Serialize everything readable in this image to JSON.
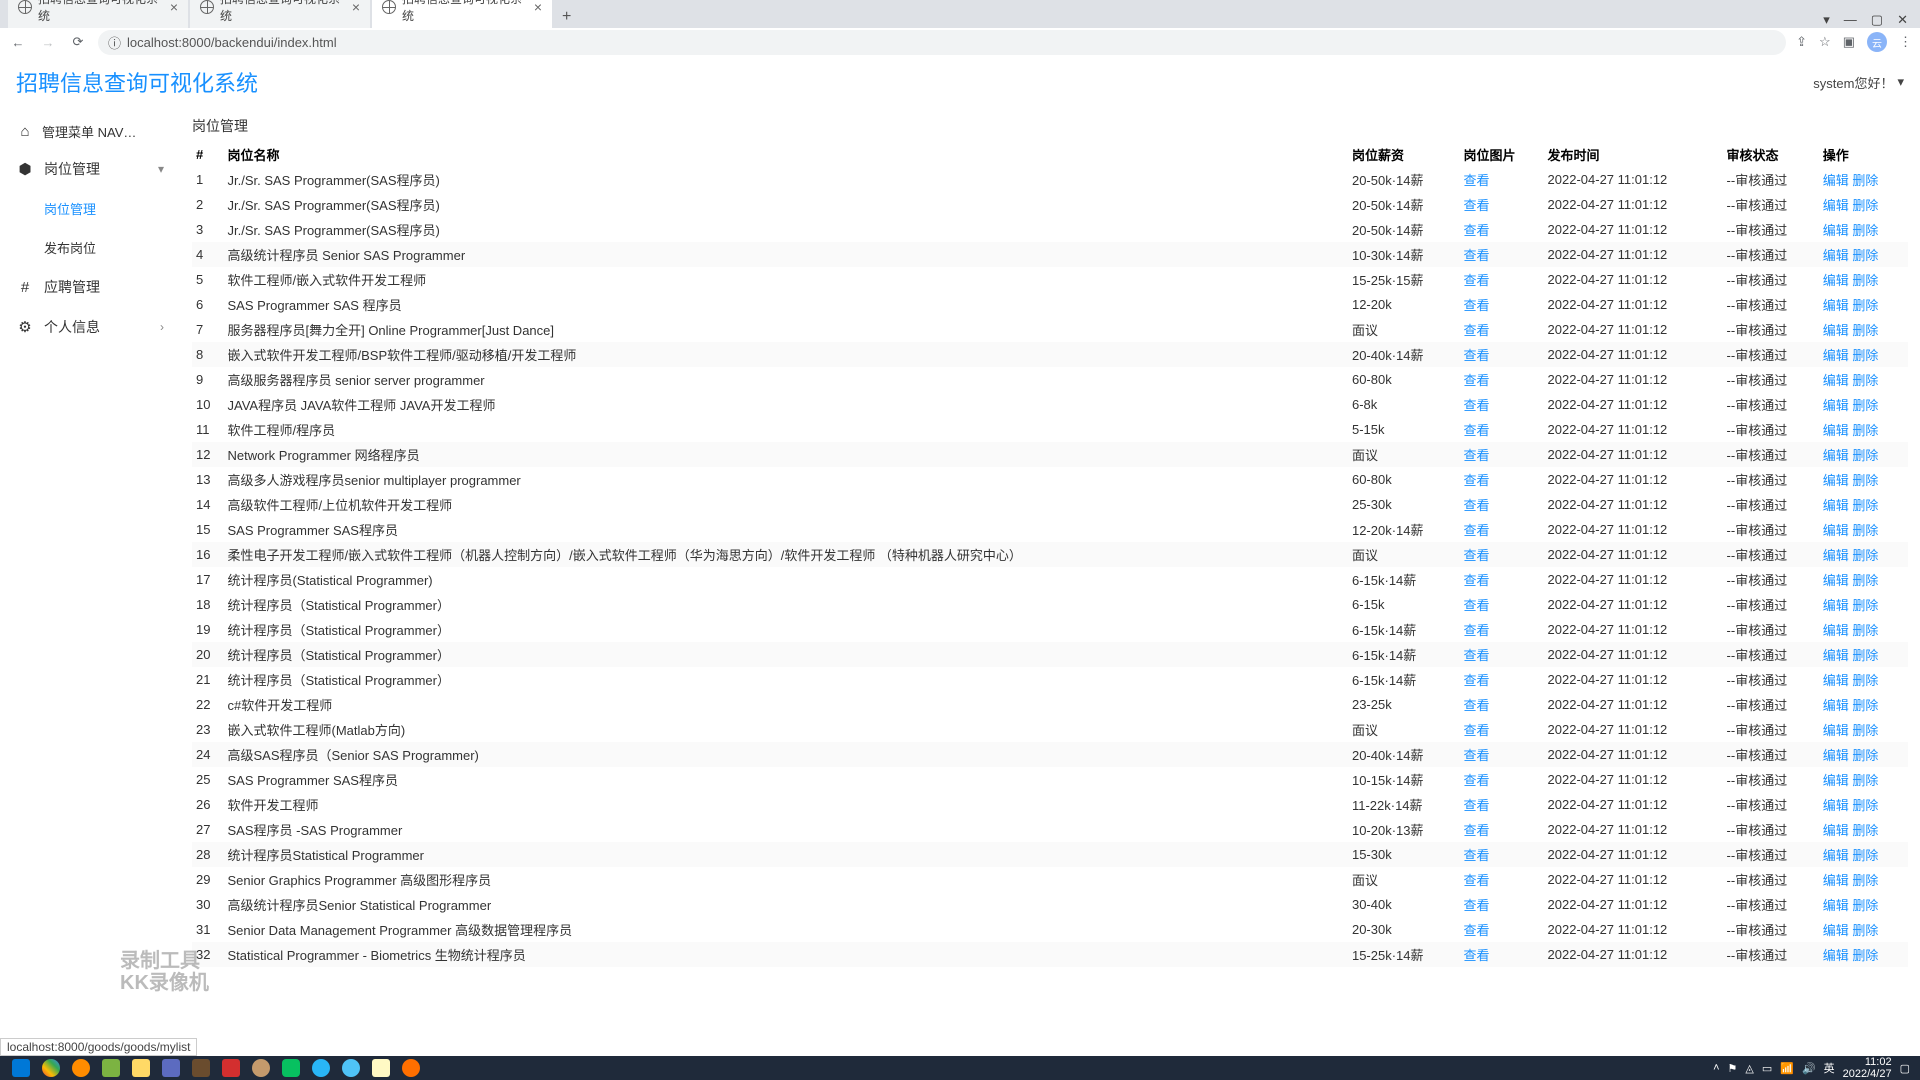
{
  "browser": {
    "tabs": [
      {
        "title": "招聘信息查询可视化系统",
        "active": false
      },
      {
        "title": "招聘信息查询可视化系统",
        "active": false
      },
      {
        "title": "招聘信息查询可视化系统",
        "active": true
      }
    ],
    "url": "localhost:8000/backendui/index.html",
    "status_url": "localhost:8000/goods/goods/mylist"
  },
  "header": {
    "app_title": "招聘信息查询可视化系统",
    "greet": "system您好！"
  },
  "sidebar": {
    "nav_head": "管理菜单 NAV…",
    "items": [
      {
        "label": "岗位管理",
        "icon": "box",
        "expandable": true,
        "state": "open"
      },
      {
        "label": "岗位管理",
        "sub": true,
        "active": true
      },
      {
        "label": "发布岗位",
        "sub": true
      },
      {
        "label": "应聘管理",
        "icon": "hash"
      },
      {
        "label": "个人信息",
        "icon": "gear",
        "expandable": true,
        "state": "closed"
      }
    ]
  },
  "main": {
    "page_title": "岗位管理",
    "columns": {
      "idx": "#",
      "name": "岗位名称",
      "salary": "岗位薪资",
      "img": "岗位图片",
      "time": "发布时间",
      "status": "审核状态",
      "ops": "操作"
    },
    "actions": {
      "view": "查看",
      "edit": "编辑",
      "del": "删除"
    },
    "rows": [
      {
        "i": 1,
        "name": "Jr./Sr. SAS Programmer(SAS程序员)",
        "salary": "20-50k·14薪",
        "img": "查看",
        "time": "2022-04-27 11:01:12",
        "status": "--审核通过"
      },
      {
        "i": 2,
        "name": "Jr./Sr. SAS Programmer(SAS程序员)",
        "salary": "20-50k·14薪",
        "img": "查看",
        "time": "2022-04-27 11:01:12",
        "status": "--审核通过"
      },
      {
        "i": 3,
        "name": "Jr./Sr. SAS Programmer(SAS程序员)",
        "salary": "20-50k·14薪",
        "img": "查看",
        "time": "2022-04-27 11:01:12",
        "status": "--审核通过"
      },
      {
        "i": 4,
        "name": "高级统计程序员 Senior SAS Programmer",
        "salary": "10-30k·14薪",
        "img": "查看",
        "time": "2022-04-27 11:01:12",
        "status": "--审核通过"
      },
      {
        "i": 5,
        "name": "软件工程师/嵌入式软件开发工程师",
        "salary": "15-25k·15薪",
        "img": "查看",
        "time": "2022-04-27 11:01:12",
        "status": "--审核通过"
      },
      {
        "i": 6,
        "name": "SAS Programmer SAS 程序员",
        "salary": "12-20k",
        "img": "查看",
        "time": "2022-04-27 11:01:12",
        "status": "--审核通过"
      },
      {
        "i": 7,
        "name": "服务器程序员[舞力全开] Online Programmer[Just Dance]",
        "salary": "面议",
        "img": "查看",
        "time": "2022-04-27 11:01:12",
        "status": "--审核通过"
      },
      {
        "i": 8,
        "name": "嵌入式软件开发工程师/BSP软件工程师/驱动移植/开发工程师",
        "salary": "20-40k·14薪",
        "img": "查看",
        "time": "2022-04-27 11:01:12",
        "status": "--审核通过"
      },
      {
        "i": 9,
        "name": "高级服务器程序员 senior server programmer",
        "salary": "60-80k",
        "img": "查看",
        "time": "2022-04-27 11:01:12",
        "status": "--审核通过"
      },
      {
        "i": 10,
        "name": "JAVA程序员 JAVA软件工程师 JAVA开发工程师",
        "salary": "6-8k",
        "img": "查看",
        "time": "2022-04-27 11:01:12",
        "status": "--审核通过"
      },
      {
        "i": 11,
        "name": "软件工程师/程序员",
        "salary": "5-15k",
        "img": "查看",
        "time": "2022-04-27 11:01:12",
        "status": "--审核通过"
      },
      {
        "i": 12,
        "name": "Network Programmer 网络程序员",
        "salary": "面议",
        "img": "查看",
        "time": "2022-04-27 11:01:12",
        "status": "--审核通过"
      },
      {
        "i": 13,
        "name": "高级多人游戏程序员senior multiplayer programmer",
        "salary": "60-80k",
        "img": "查看",
        "time": "2022-04-27 11:01:12",
        "status": "--审核通过"
      },
      {
        "i": 14,
        "name": "高级软件工程师/上位机软件开发工程师",
        "salary": "25-30k",
        "img": "查看",
        "time": "2022-04-27 11:01:12",
        "status": "--审核通过"
      },
      {
        "i": 15,
        "name": "SAS Programmer SAS程序员",
        "salary": "12-20k·14薪",
        "img": "查看",
        "time": "2022-04-27 11:01:12",
        "status": "--审核通过"
      },
      {
        "i": 16,
        "name": "柔性电子开发工程师/嵌入式软件工程师（机器人控制方向）/嵌入式软件工程师（华为海思方向）/软件开发工程师 （特种机器人研究中心）",
        "salary": "面议",
        "img": "查看",
        "time": "2022-04-27 11:01:12",
        "status": "--审核通过"
      },
      {
        "i": 17,
        "name": "统计程序员(Statistical Programmer)",
        "salary": "6-15k·14薪",
        "img": "查看",
        "time": "2022-04-27 11:01:12",
        "status": "--审核通过"
      },
      {
        "i": 18,
        "name": "统计程序员（Statistical Programmer）",
        "salary": "6-15k",
        "img": "查看",
        "time": "2022-04-27 11:01:12",
        "status": "--审核通过"
      },
      {
        "i": 19,
        "name": "统计程序员（Statistical Programmer）",
        "salary": "6-15k·14薪",
        "img": "查看",
        "time": "2022-04-27 11:01:12",
        "status": "--审核通过"
      },
      {
        "i": 20,
        "name": "统计程序员（Statistical Programmer）",
        "salary": "6-15k·14薪",
        "img": "查看",
        "time": "2022-04-27 11:01:12",
        "status": "--审核通过"
      },
      {
        "i": 21,
        "name": "统计程序员（Statistical Programmer）",
        "salary": "6-15k·14薪",
        "img": "查看",
        "time": "2022-04-27 11:01:12",
        "status": "--审核通过"
      },
      {
        "i": 22,
        "name": "c#软件开发工程师",
        "salary": "23-25k",
        "img": "查看",
        "time": "2022-04-27 11:01:12",
        "status": "--审核通过"
      },
      {
        "i": 23,
        "name": "嵌入式软件工程师(Matlab方向)",
        "salary": "面议",
        "img": "查看",
        "time": "2022-04-27 11:01:12",
        "status": "--审核通过"
      },
      {
        "i": 24,
        "name": "高级SAS程序员（Senior SAS Programmer)",
        "salary": "20-40k·14薪",
        "img": "查看",
        "time": "2022-04-27 11:01:12",
        "status": "--审核通过"
      },
      {
        "i": 25,
        "name": "SAS Programmer SAS程序员",
        "salary": "10-15k·14薪",
        "img": "查看",
        "time": "2022-04-27 11:01:12",
        "status": "--审核通过"
      },
      {
        "i": 26,
        "name": "软件开发工程师",
        "salary": "11-22k·14薪",
        "img": "查看",
        "time": "2022-04-27 11:01:12",
        "status": "--审核通过"
      },
      {
        "i": 27,
        "name": "SAS程序员 -SAS Programmer",
        "salary": "10-20k·13薪",
        "img": "查看",
        "time": "2022-04-27 11:01:12",
        "status": "--审核通过"
      },
      {
        "i": 28,
        "name": "统计程序员Statistical Programmer",
        "salary": "15-30k",
        "img": "查看",
        "time": "2022-04-27 11:01:12",
        "status": "--审核通过"
      },
      {
        "i": 29,
        "name": "Senior Graphics Programmer 高级图形程序员",
        "salary": "面议",
        "img": "查看",
        "time": "2022-04-27 11:01:12",
        "status": "--审核通过"
      },
      {
        "i": 30,
        "name": "高级统计程序员Senior Statistical Programmer",
        "salary": "30-40k",
        "img": "查看",
        "time": "2022-04-27 11:01:12",
        "status": "--审核通过"
      },
      {
        "i": 31,
        "name": "Senior Data Management Programmer 高级数据管理程序员",
        "salary": "20-30k",
        "img": "查看",
        "time": "2022-04-27 11:01:12",
        "status": "--审核通过"
      },
      {
        "i": 32,
        "name": "Statistical Programmer - Biometrics 生物统计程序员",
        "salary": "15-25k·14薪",
        "img": "查看",
        "time": "2022-04-27 11:01:12",
        "status": "--审核通过"
      }
    ]
  },
  "watermark": {
    "l1": "录制工具",
    "l2": "KK录像机"
  },
  "taskbar": {
    "time": "11:02",
    "date": "2022/4/27",
    "ime": "英"
  }
}
